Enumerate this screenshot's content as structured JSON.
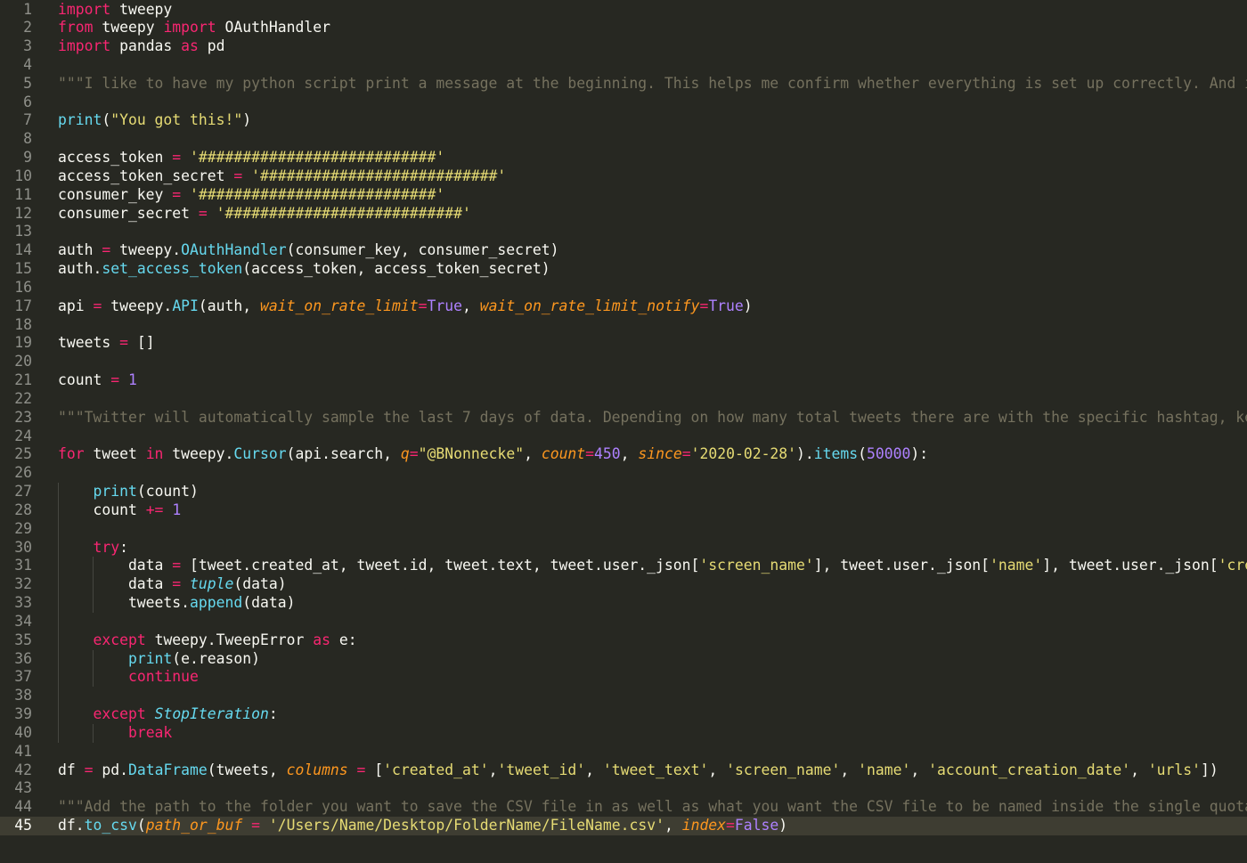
{
  "editor": {
    "current_line": 45,
    "lines": [
      {
        "n": "1",
        "tokens": [
          [
            "import",
            "kw"
          ],
          [
            " tweepy",
            "plain"
          ]
        ]
      },
      {
        "n": "2",
        "tokens": [
          [
            "from",
            "kw"
          ],
          [
            " tweepy ",
            "plain"
          ],
          [
            "import",
            "kw"
          ],
          [
            " OAuthHandler",
            "plain"
          ]
        ]
      },
      {
        "n": "3",
        "tokens": [
          [
            "import",
            "kw"
          ],
          [
            " pandas ",
            "plain"
          ],
          [
            "as",
            "kw"
          ],
          [
            " pd",
            "plain"
          ]
        ]
      },
      {
        "n": "4",
        "tokens": []
      },
      {
        "n": "5",
        "tokens": [
          [
            "\"\"\"I like to have my python script print a message at the beginning. This helps me confirm whether everything is set up correctly. And it",
            "com"
          ]
        ]
      },
      {
        "n": "6",
        "tokens": []
      },
      {
        "n": "7",
        "tokens": [
          [
            "print",
            "fn"
          ],
          [
            "(",
            "plain"
          ],
          [
            "\"You got this!\"",
            "str"
          ],
          [
            ")",
            "plain"
          ]
        ]
      },
      {
        "n": "8",
        "tokens": []
      },
      {
        "n": "9",
        "tokens": [
          [
            "access_token ",
            "plain"
          ],
          [
            "=",
            "op"
          ],
          [
            " ",
            "plain"
          ],
          [
            "'###########################'",
            "str"
          ]
        ]
      },
      {
        "n": "10",
        "tokens": [
          [
            "access_token_secret ",
            "plain"
          ],
          [
            "=",
            "op"
          ],
          [
            " ",
            "plain"
          ],
          [
            "'###########################'",
            "str"
          ]
        ]
      },
      {
        "n": "11",
        "tokens": [
          [
            "consumer_key ",
            "plain"
          ],
          [
            "=",
            "op"
          ],
          [
            " ",
            "plain"
          ],
          [
            "'###########################'",
            "str"
          ]
        ]
      },
      {
        "n": "12",
        "tokens": [
          [
            "consumer_secret ",
            "plain"
          ],
          [
            "=",
            "op"
          ],
          [
            " ",
            "plain"
          ],
          [
            "'###########################'",
            "str"
          ]
        ]
      },
      {
        "n": "13",
        "tokens": []
      },
      {
        "n": "14",
        "tokens": [
          [
            "auth ",
            "plain"
          ],
          [
            "=",
            "op"
          ],
          [
            " tweepy.",
            "plain"
          ],
          [
            "OAuthHandler",
            "fn"
          ],
          [
            "(consumer_key, consumer_secret)",
            "plain"
          ]
        ]
      },
      {
        "n": "15",
        "tokens": [
          [
            "auth.",
            "plain"
          ],
          [
            "set_access_token",
            "fn"
          ],
          [
            "(access_token, access_token_secret)",
            "plain"
          ]
        ]
      },
      {
        "n": "16",
        "tokens": []
      },
      {
        "n": "17",
        "tokens": [
          [
            "api ",
            "plain"
          ],
          [
            "=",
            "op"
          ],
          [
            " tweepy.",
            "plain"
          ],
          [
            "API",
            "fn"
          ],
          [
            "(auth, ",
            "plain"
          ],
          [
            "wait_on_rate_limit",
            "param"
          ],
          [
            "=",
            "op"
          ],
          [
            "True",
            "const"
          ],
          [
            ", ",
            "plain"
          ],
          [
            "wait_on_rate_limit_notify",
            "param"
          ],
          [
            "=",
            "op"
          ],
          [
            "True",
            "const"
          ],
          [
            ")",
            "plain"
          ]
        ]
      },
      {
        "n": "18",
        "tokens": []
      },
      {
        "n": "19",
        "tokens": [
          [
            "tweets ",
            "plain"
          ],
          [
            "=",
            "op"
          ],
          [
            " []",
            "plain"
          ]
        ]
      },
      {
        "n": "20",
        "tokens": []
      },
      {
        "n": "21",
        "tokens": [
          [
            "count ",
            "plain"
          ],
          [
            "=",
            "op"
          ],
          [
            " ",
            "plain"
          ],
          [
            "1",
            "num"
          ]
        ]
      },
      {
        "n": "22",
        "tokens": []
      },
      {
        "n": "23",
        "tokens": [
          [
            "\"\"\"Twitter will automatically sample the last 7 days of data. Depending on how many total tweets there are with the specific hashtag, keyw",
            "com"
          ]
        ]
      },
      {
        "n": "24",
        "tokens": []
      },
      {
        "n": "25",
        "tokens": [
          [
            "for",
            "kw"
          ],
          [
            " tweet ",
            "plain"
          ],
          [
            "in",
            "kw"
          ],
          [
            " tweepy.",
            "plain"
          ],
          [
            "Cursor",
            "fn"
          ],
          [
            "(api.search, ",
            "plain"
          ],
          [
            "q",
            "param"
          ],
          [
            "=",
            "op"
          ],
          [
            "\"@BNonnecke\"",
            "str"
          ],
          [
            ", ",
            "plain"
          ],
          [
            "count",
            "param"
          ],
          [
            "=",
            "op"
          ],
          [
            "450",
            "num"
          ],
          [
            ", ",
            "plain"
          ],
          [
            "since",
            "param"
          ],
          [
            "=",
            "op"
          ],
          [
            "'2020-02-28'",
            "str"
          ],
          [
            ").",
            "plain"
          ],
          [
            "items",
            "fn"
          ],
          [
            "(",
            "plain"
          ],
          [
            "50000",
            "num"
          ],
          [
            "):",
            "plain"
          ]
        ]
      },
      {
        "n": "26",
        "tokens": []
      },
      {
        "n": "27",
        "tokens": [
          [
            "    ",
            "plain"
          ],
          [
            "print",
            "fn"
          ],
          [
            "(count)",
            "plain"
          ]
        ]
      },
      {
        "n": "28",
        "tokens": [
          [
            "    count ",
            "plain"
          ],
          [
            "+=",
            "op"
          ],
          [
            " ",
            "plain"
          ],
          [
            "1",
            "num"
          ]
        ]
      },
      {
        "n": "29",
        "tokens": []
      },
      {
        "n": "30",
        "tokens": [
          [
            "    ",
            "plain"
          ],
          [
            "try",
            "kw"
          ],
          [
            ":",
            "plain"
          ]
        ]
      },
      {
        "n": "31",
        "tokens": [
          [
            "        data ",
            "plain"
          ],
          [
            "=",
            "op"
          ],
          [
            " [tweet.created_at, tweet.id, tweet.text, tweet.user._json[",
            "plain"
          ],
          [
            "'screen_name'",
            "str"
          ],
          [
            "], tweet.user._json[",
            "plain"
          ],
          [
            "'name'",
            "str"
          ],
          [
            "], tweet.user._json[",
            "plain"
          ],
          [
            "'crea",
            "str"
          ]
        ]
      },
      {
        "n": "32",
        "tokens": [
          [
            "        data ",
            "plain"
          ],
          [
            "=",
            "op"
          ],
          [
            " ",
            "plain"
          ],
          [
            "tuple",
            "cls"
          ],
          [
            "(data)",
            "plain"
          ]
        ]
      },
      {
        "n": "33",
        "tokens": [
          [
            "        tweets.",
            "plain"
          ],
          [
            "append",
            "fn"
          ],
          [
            "(data)",
            "plain"
          ]
        ]
      },
      {
        "n": "34",
        "tokens": []
      },
      {
        "n": "35",
        "tokens": [
          [
            "    ",
            "plain"
          ],
          [
            "except",
            "kw"
          ],
          [
            " tweepy.TweepError ",
            "plain"
          ],
          [
            "as",
            "kw"
          ],
          [
            " e:",
            "plain"
          ]
        ]
      },
      {
        "n": "36",
        "tokens": [
          [
            "        ",
            "plain"
          ],
          [
            "print",
            "fn"
          ],
          [
            "(e.reason)",
            "plain"
          ]
        ]
      },
      {
        "n": "37",
        "tokens": [
          [
            "        ",
            "plain"
          ],
          [
            "continue",
            "kw"
          ]
        ]
      },
      {
        "n": "38",
        "tokens": []
      },
      {
        "n": "39",
        "tokens": [
          [
            "    ",
            "plain"
          ],
          [
            "except",
            "kw"
          ],
          [
            " ",
            "plain"
          ],
          [
            "StopIteration",
            "cls"
          ],
          [
            ":",
            "plain"
          ]
        ]
      },
      {
        "n": "40",
        "tokens": [
          [
            "        ",
            "plain"
          ],
          [
            "break",
            "kw"
          ]
        ]
      },
      {
        "n": "41",
        "tokens": []
      },
      {
        "n": "42",
        "tokens": [
          [
            "df ",
            "plain"
          ],
          [
            "=",
            "op"
          ],
          [
            " pd.",
            "plain"
          ],
          [
            "DataFrame",
            "fn"
          ],
          [
            "(tweets, ",
            "plain"
          ],
          [
            "columns",
            "param"
          ],
          [
            " ",
            "plain"
          ],
          [
            "=",
            "op"
          ],
          [
            " [",
            "plain"
          ],
          [
            "'created_at'",
            "str"
          ],
          [
            ",",
            "plain"
          ],
          [
            "'tweet_id'",
            "str"
          ],
          [
            ", ",
            "plain"
          ],
          [
            "'tweet_text'",
            "str"
          ],
          [
            ", ",
            "plain"
          ],
          [
            "'screen_name'",
            "str"
          ],
          [
            ", ",
            "plain"
          ],
          [
            "'name'",
            "str"
          ],
          [
            ", ",
            "plain"
          ],
          [
            "'account_creation_date'",
            "str"
          ],
          [
            ", ",
            "plain"
          ],
          [
            "'urls'",
            "str"
          ],
          [
            "])",
            "plain"
          ]
        ]
      },
      {
        "n": "43",
        "tokens": []
      },
      {
        "n": "44",
        "tokens": [
          [
            "\"\"\"Add the path to the folder you want to save the CSV file in as well as what you want the CSV file to be named inside the single quotat",
            "com"
          ]
        ]
      },
      {
        "n": "45",
        "tokens": [
          [
            "df.",
            "plain"
          ],
          [
            "to_csv",
            "fn"
          ],
          [
            "(",
            "plain"
          ],
          [
            "path_or_buf",
            "param"
          ],
          [
            " ",
            "plain"
          ],
          [
            "=",
            "op"
          ],
          [
            " ",
            "plain"
          ],
          [
            "'/Users/Name/Desktop/FolderName/FileName.csv'",
            "str"
          ],
          [
            ", ",
            "plain"
          ],
          [
            "index",
            "param"
          ],
          [
            "=",
            "op"
          ],
          [
            "False",
            "const"
          ],
          [
            ")",
            "plain"
          ]
        ]
      }
    ]
  }
}
